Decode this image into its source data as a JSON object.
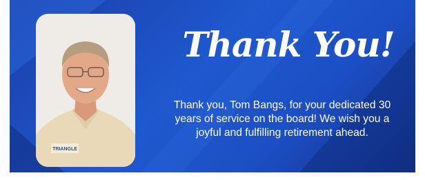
{
  "banner": {
    "headline": "Thank You!",
    "message_lines": [
      "Thank you, Tom Bangs, for your dedicated 30",
      "years of service on the board! We wish you a",
      "joyful and fulfilling retirement ahead."
    ],
    "shirt_logo_text": "TRIANGLE",
    "colors": {
      "background_dark": "#12318a",
      "background_mid": "#1f58cf",
      "text": "#ffffff",
      "outer": "#ffffff"
    }
  }
}
